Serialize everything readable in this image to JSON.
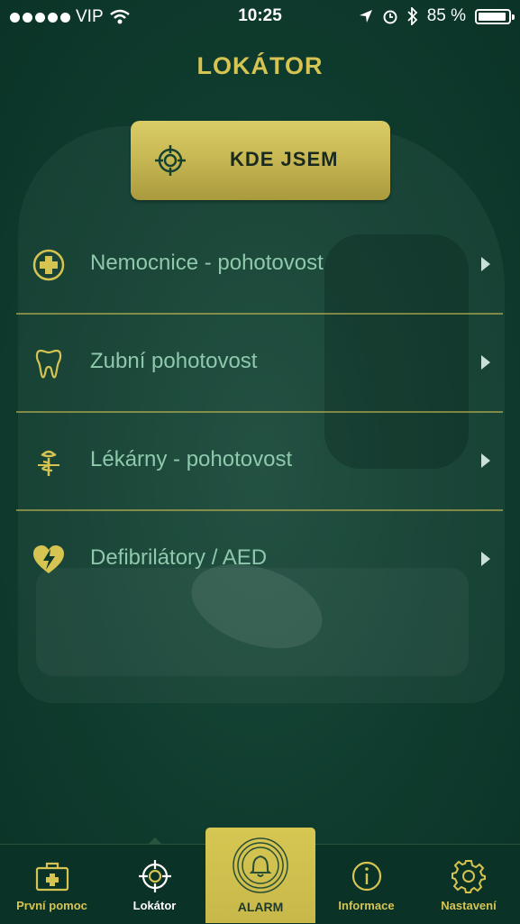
{
  "status": {
    "carrier": "VIP",
    "time": "10:25",
    "battery": "85 %"
  },
  "screen": {
    "title": "LOKÁTOR"
  },
  "locate_button": {
    "label": "KDE JSEM",
    "icon": "crosshair-icon"
  },
  "list": {
    "items": [
      {
        "label": "Nemocnice - pohotovost",
        "icon": "hospital-cross-icon"
      },
      {
        "label": "Zubní pohotovost",
        "icon": "tooth-icon"
      },
      {
        "label": "Lékárny - pohotovost",
        "icon": "pharmacy-icon"
      },
      {
        "label": "Defibrilátory / AED",
        "icon": "defibrillator-heart-icon"
      }
    ]
  },
  "tabs": [
    {
      "label": "První pomoc",
      "icon": "first-aid-kit-icon",
      "active": false
    },
    {
      "label": "Lokátor",
      "icon": "crosshair-icon",
      "active": true
    },
    {
      "label": "ALARM",
      "icon": "bell-icon"
    },
    {
      "label": "Informace",
      "icon": "info-icon",
      "active": false
    },
    {
      "label": "Nastavení",
      "icon": "gear-icon",
      "active": false
    }
  ],
  "colors": {
    "background": "#0d3a2c",
    "accent_gold": "#d6c452",
    "list_text": "#8fc9ad"
  }
}
